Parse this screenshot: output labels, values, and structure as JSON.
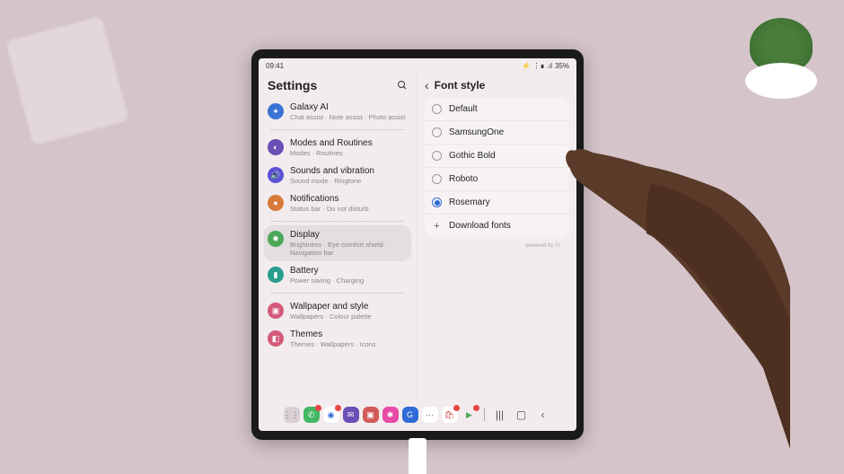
{
  "status": {
    "time": "09:41",
    "battery": "35%",
    "signal": "⚡ ⋮∎ .ıl"
  },
  "leftPane": {
    "title": "Settings"
  },
  "settings": [
    {
      "icon_bg": "#3b73d4",
      "icon": "✦",
      "label": "Galaxy AI",
      "sub": "Chat assist · Note assist · Photo assist"
    },
    {
      "icon_bg": "#6a4fb5",
      "icon": "◐",
      "label": "Modes and Routines",
      "sub": "Modes · Routines"
    },
    {
      "icon_bg": "#5b52d4",
      "icon": "🔊",
      "label": "Sounds and vibration",
      "sub": "Sound mode · Ringtone"
    },
    {
      "icon_bg": "#d87a3a",
      "icon": "●",
      "label": "Notifications",
      "sub": "Status bar · Do not disturb"
    },
    {
      "icon_bg": "#4ba858",
      "icon": "✹",
      "label": "Display",
      "sub": "Brightness · Eye comfort shield · Navigation bar",
      "selected": true
    },
    {
      "icon_bg": "#2a9e8e",
      "icon": "▮",
      "label": "Battery",
      "sub": "Power saving · Charging"
    },
    {
      "icon_bg": "#d45a7a",
      "icon": "▣",
      "label": "Wallpaper and style",
      "sub": "Wallpapers · Colour palette"
    },
    {
      "icon_bg": "#d45a7a",
      "icon": "◧",
      "label": "Themes",
      "sub": "Themes · Wallpapers · Icons"
    }
  ],
  "dividers_after": [
    0,
    3,
    5
  ],
  "rightPane": {
    "title": "Font style",
    "selected": 4,
    "options": [
      {
        "label": "Default"
      },
      {
        "label": "SamsungOne"
      },
      {
        "label": "Gothic Bold"
      },
      {
        "label": "Roboto"
      },
      {
        "label": "Rosemary"
      }
    ],
    "download": "Download fonts",
    "powered": "powered by ⓜ"
  },
  "dock": [
    {
      "bg": "#d8d0d4",
      "glyph": "⋮⋮",
      "color": "#666"
    },
    {
      "bg": "#43b965",
      "glyph": "✆",
      "badge": ""
    },
    {
      "bg": "#fff",
      "glyph": "◉",
      "color": "#2e6bd6",
      "badge": ""
    },
    {
      "bg": "#6a4fb5",
      "glyph": "✉"
    },
    {
      "bg": "#d45a5a",
      "glyph": "▣"
    },
    {
      "bg": "#e84ba8",
      "glyph": "✱"
    },
    {
      "bg": "#2e6bd6",
      "glyph": "G"
    },
    {
      "bg": "#fff",
      "glyph": "⋯",
      "color": "#666"
    },
    {
      "bg": "#fff",
      "glyph": "🛍",
      "color": "#d45a5a",
      "badge": ""
    },
    {
      "bg": "transparent",
      "glyph": "▶",
      "color": "#4ba858",
      "badge": ""
    }
  ]
}
